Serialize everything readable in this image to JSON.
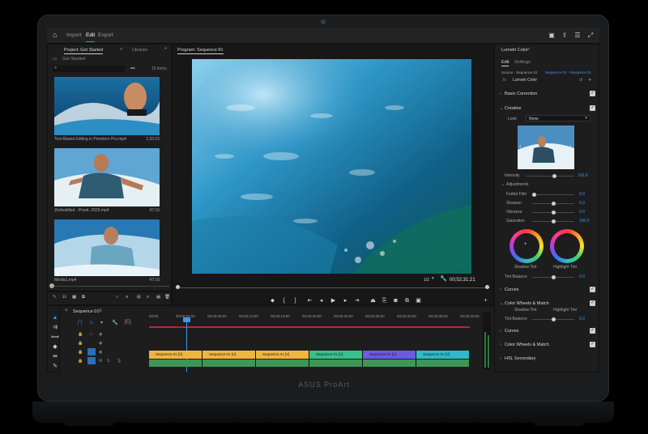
{
  "device": {
    "brand": "ASUS ProArt"
  },
  "header": {
    "tabs": [
      "Import",
      "Edit",
      "Export"
    ],
    "active_tab": "Edit"
  },
  "project_panel": {
    "tab_project": "Project: Get Started",
    "tab_libraries": "Libraries",
    "bin_label": "Get Started",
    "item_count": "15 items",
    "items": [
      {
        "name": "Text-Based Editing in Premiere Pro.mp4",
        "duration": "1:33:15"
      },
      {
        "name": "Zimbokilled - Presit. 2026.mp4",
        "duration": "47:16"
      },
      {
        "name": "Media1.mp4",
        "duration": "47:16"
      }
    ]
  },
  "program_monitor": {
    "title": "Program: Sequence 01",
    "zoom": "1/2",
    "timecode": "00;52;31;21"
  },
  "timeline": {
    "sequence_tab": "Sequence 01",
    "ruler": [
      "00;00",
      "00;00;04;00",
      "00;00;08;00",
      "00;00;12;00",
      "00;00;16;00",
      "00;00;20;00",
      "00;00;24;00",
      "00;00;28;00",
      "00;00;32;00",
      "00;00;36;00",
      "00;00;40;00"
    ],
    "clips": [
      {
        "label": "Sequence 01 [V]",
        "color": "#f0b541"
      },
      {
        "label": "Sequence 01 [V]",
        "color": "#f0b541"
      },
      {
        "label": "Sequence 01 [V]",
        "color": "#f0b541"
      },
      {
        "label": "Sequence 01 [V]",
        "color": "#38c08a"
      },
      {
        "label": "Sequence 01 [V]",
        "color": "#6a5ae6"
      },
      {
        "label": "Sequence 01 [V]",
        "color": "#2fb9c9"
      }
    ]
  },
  "lumetri": {
    "panel_title": "Lumetri Color",
    "tab_edit": "Edit",
    "tab_settings": "Settings",
    "source": "Source - Sequence 01",
    "target": "Sequence 01 - Sequence 01",
    "effect_name": "Lumetri Color",
    "sections": {
      "basic_correction": "Basic Correction",
      "creative": "Creative",
      "curves": "Curves",
      "color_wheels": "Color Wheels & Match",
      "hsl": "HSL Secondary"
    },
    "look_label": "Look",
    "look_value": "None",
    "intensity_label": "Intensity",
    "intensity_value": "100.0",
    "adjustments_label": "Adjustments",
    "adjustments": [
      {
        "label": "Faded Film",
        "value": "0.0",
        "level": 0
      },
      {
        "label": "Sharpen",
        "value": "0.0",
        "level": 0.5
      },
      {
        "label": "Vibrance",
        "value": "0.0",
        "level": 0.5
      },
      {
        "label": "Saturation",
        "value": "100.0",
        "level": 0.5
      }
    ],
    "shadow_tint": "Shadow Tint",
    "highlight_tint": "Highlight Tint",
    "tint_balance_label": "Tint Balance",
    "tint_balance_value": "0.0",
    "accent_color": "#3b97f0"
  }
}
